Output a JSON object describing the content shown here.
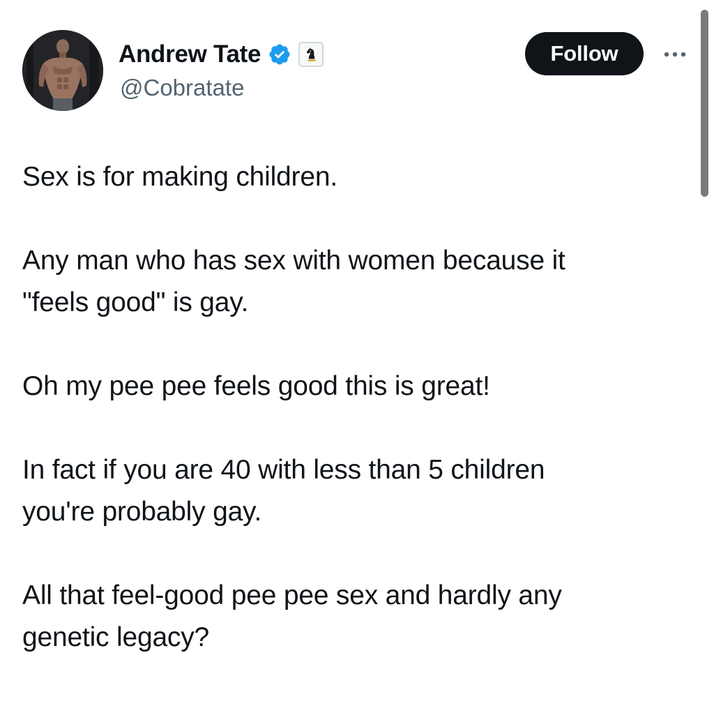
{
  "author": {
    "display_name": "Andrew Tate",
    "handle": "@Cobratate",
    "avatar_icon": "profile-photo",
    "verified_icon": "verified-badge-icon",
    "verified_color": "#1d9bf0",
    "affiliate_icon": "chess-knight-icon"
  },
  "actions": {
    "follow_label": "Follow",
    "more_icon": "more-options-icon"
  },
  "tweet": {
    "paragraphs": [
      "Sex is for making children.",
      "Any man who has sex with women because it\n\"feels good\" is gay.",
      "Oh my pee pee feels good this is great!",
      "In fact if you are 40 with less than 5 children\nyou're probably gay.",
      "All that feel-good pee pee sex and hardly any\ngenetic legacy?"
    ]
  },
  "colors": {
    "text": "#0f1419",
    "secondary_text": "#536471",
    "button_bg": "#0f1419",
    "button_text": "#ffffff"
  }
}
